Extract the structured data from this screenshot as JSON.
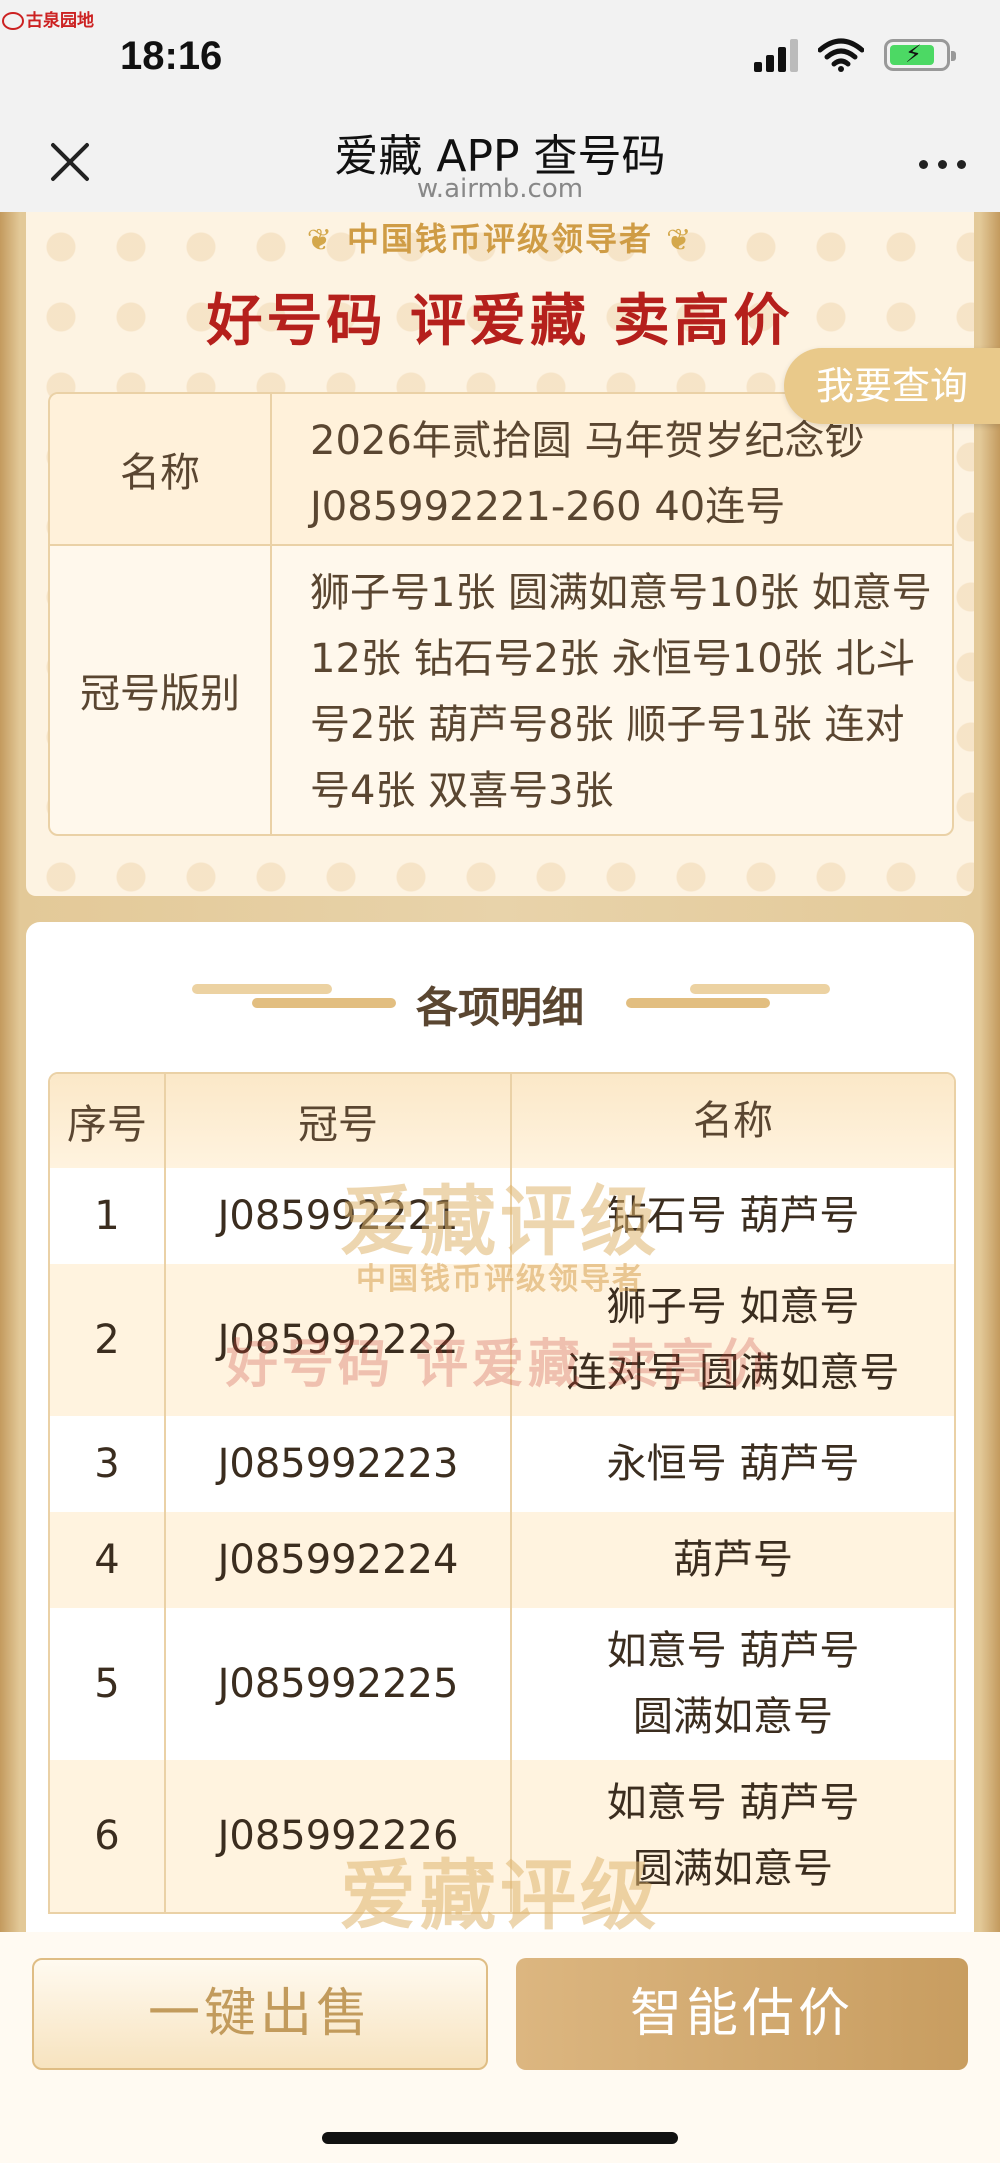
{
  "status_bar": {
    "watermark": "古泉园地",
    "time": "18:16"
  },
  "nav": {
    "title": "爱藏 APP 查号码",
    "url": "w.airmb.com"
  },
  "banner": {
    "leader": "中国钱币评级领导者",
    "slogan": "好号码 评爱藏 卖高价",
    "query_button": "我要查询"
  },
  "info": {
    "name_label": "名称",
    "name_value": "2026年贰拾圆 马年贺岁纪念钞\nJ085992221-260 40连号",
    "crown_label": "冠号版别",
    "crown_value": "狮子号1张 圆满如意号10张 如意号12张 钻石号2张 永恒号10张 北斗号2张 葫芦号8张 顺子号1张 连对号4张 双喜号3张"
  },
  "details": {
    "title": "各项明细",
    "headers": {
      "index": "序号",
      "crown": "冠号",
      "name": "名称"
    },
    "rows": [
      {
        "index": "1",
        "crown": "J085992221",
        "name": "钻石号 葫芦号"
      },
      {
        "index": "2",
        "crown": "J085992222",
        "name": "狮子号 如意号\n连对号 圆满如意号"
      },
      {
        "index": "3",
        "crown": "J085992223",
        "name": "永恒号 葫芦号"
      },
      {
        "index": "4",
        "crown": "J085992224",
        "name": "葫芦号"
      },
      {
        "index": "5",
        "crown": "J085992225",
        "name": "如意号 葫芦号\n圆满如意号"
      },
      {
        "index": "6",
        "crown": "J085992226",
        "name": "如意号 葫芦号\n圆满如意号"
      }
    ]
  },
  "watermarks": {
    "big": "爱藏评级",
    "mid": "中国钱币评级领导者",
    "red": "好号码 评爱藏 卖高价"
  },
  "bottom": {
    "sell_button": "一键出售",
    "estimate_button": "智能估价"
  },
  "colors": {
    "gold": "#c9a56d",
    "slogan_red": "#b5201c",
    "button_gold": "#c89d60"
  },
  "icons": [
    "close-icon",
    "more-icon",
    "signal-icon",
    "wifi-icon",
    "battery-icon"
  ]
}
